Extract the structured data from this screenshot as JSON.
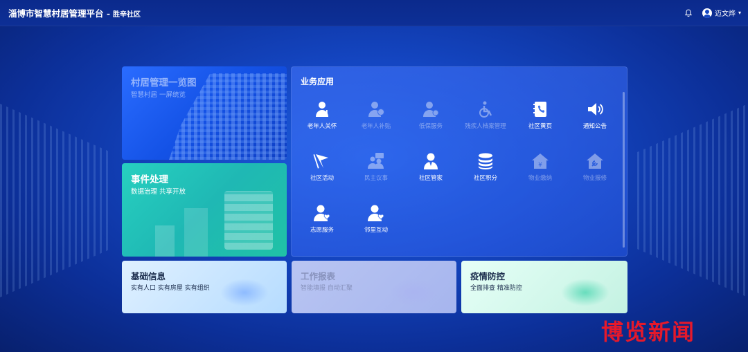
{
  "header": {
    "title": "淄博市智慧村居管理平台 -",
    "community": "胜辛社区",
    "user_name": "迈文烨",
    "caret": "▾"
  },
  "cards": {
    "overview": {
      "title": "村居管理一览图",
      "subtitle": "智慧村居 一屏统览"
    },
    "event": {
      "title": "事件处理",
      "subtitle": "数据治理 共享开放"
    },
    "apps": {
      "title": "业务应用",
      "items": [
        {
          "label": "老年人关怀",
          "icon": "elderly-icon",
          "enabled": true
        },
        {
          "label": "老年人补贴",
          "icon": "elderly-subsidy-icon",
          "enabled": false
        },
        {
          "label": "低保服务",
          "icon": "welfare-icon",
          "enabled": false
        },
        {
          "label": "残疾人档案管理",
          "icon": "wheelchair-icon",
          "enabled": false
        },
        {
          "label": "社区黄页",
          "icon": "phonebook-icon",
          "enabled": true
        },
        {
          "label": "通知公告",
          "icon": "speaker-icon",
          "enabled": true
        },
        {
          "label": "社区活动",
          "icon": "flag-icon",
          "enabled": true
        },
        {
          "label": "民主议事",
          "icon": "discussion-icon",
          "enabled": false
        },
        {
          "label": "社区管家",
          "icon": "steward-icon",
          "enabled": true
        },
        {
          "label": "社区积分",
          "icon": "coins-icon",
          "enabled": true
        },
        {
          "label": "物业缴纳",
          "icon": "property-payment-icon",
          "enabled": false
        },
        {
          "label": "物业报修",
          "icon": "repair-icon",
          "enabled": false
        },
        {
          "label": "志愿服务",
          "icon": "volunteer-icon",
          "enabled": true
        },
        {
          "label": "邻里互动",
          "icon": "neighbor-icon",
          "enabled": true
        }
      ]
    },
    "basic": {
      "title": "基础信息",
      "subtitle": "实有人口 实有房屋 实有组织"
    },
    "report": {
      "title": "工作报表",
      "subtitle": "智能填报 自动汇聚"
    },
    "epidemic": {
      "title": "疫情防控",
      "subtitle": "全面排查 精准防控"
    }
  },
  "watermark": "博览新闻"
}
